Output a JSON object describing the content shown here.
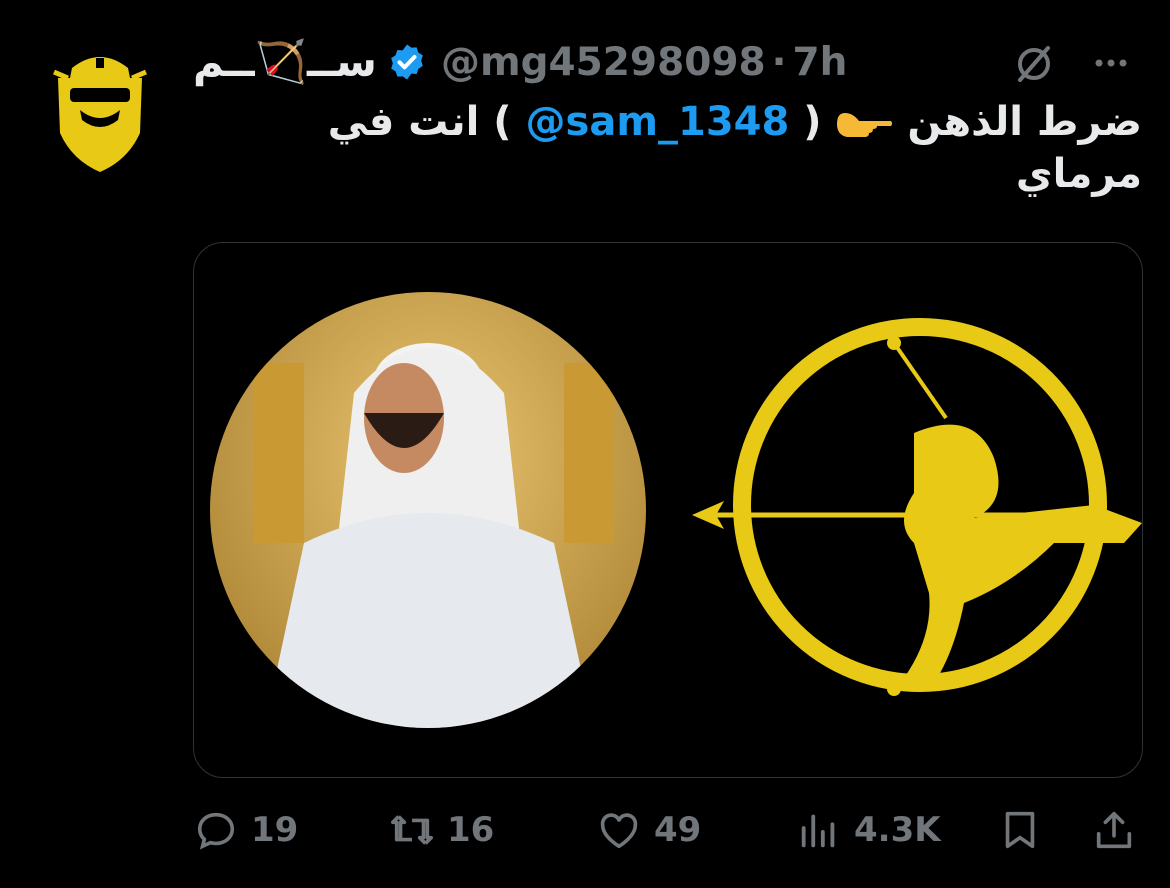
{
  "tweet": {
    "display_name": "ســ🏹ــم",
    "handle": "@mg45298098",
    "separator": "·",
    "time": "7h",
    "text_before": "ضرط الذهن",
    "text_open_paren": "(",
    "mention": "@sam_1348",
    "text_after": ") انت في مرماي",
    "verified": true
  },
  "actions": {
    "replies": "19",
    "reposts": "16",
    "likes": "49",
    "views": "4.3K"
  },
  "icons": {
    "grok": "grok-icon",
    "more": "more-icon",
    "reply": "reply-icon",
    "repost": "repost-icon",
    "like": "heart-icon",
    "views": "analytics-icon",
    "bookmark": "bookmark-icon",
    "share": "share-icon"
  },
  "colors": {
    "background": "#000000",
    "text": "#e7e9ea",
    "muted": "#71767b",
    "accent": "#1d9bf0",
    "logo_yellow": "#e8c916"
  }
}
